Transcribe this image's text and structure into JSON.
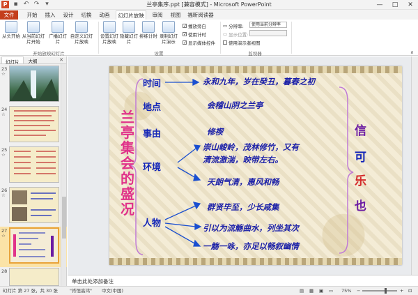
{
  "window": {
    "title": "兰亭集序.ppt [兼容模式] - Microsoft PowerPoint",
    "app_logo": "P",
    "controls": [
      "—",
      "□",
      "✕"
    ]
  },
  "tabs": [
    {
      "label": "文件"
    },
    {
      "label": "开始"
    },
    {
      "label": "插入"
    },
    {
      "label": "设计"
    },
    {
      "label": "切换"
    },
    {
      "label": "动画"
    },
    {
      "label": "幻灯片放映"
    },
    {
      "label": "审阅"
    },
    {
      "label": "视图"
    },
    {
      "label": "福昕阅读器"
    }
  ],
  "ribbon": {
    "from_start": "从头开始",
    "from_current": "从当前幻灯片开始",
    "broadcast": "广播幻灯片",
    "custom_show": "自定义幻灯片放映",
    "group1": "开始放映幻灯片",
    "setup_show": "设置幻灯片放映",
    "hide_slide": "隐藏幻灯片",
    "rehearse": "排练计时",
    "record": "录制幻灯片演示",
    "chk_narration": "播放旁白",
    "chk_timing": "使用计时",
    "chk_media": "显示媒体控件",
    "group2": "设置",
    "resolution_label": "分辨率:",
    "resolution_value": "使用当前分辨率",
    "display_label": "显示位置:",
    "presenter_view": "使用演示者视图",
    "group3": "监视器"
  },
  "leftpane": {
    "tab_slides": "幻灯片",
    "tab_outline": "大纲",
    "close": "✕",
    "slides": [
      {
        "num": "23"
      },
      {
        "num": "24"
      },
      {
        "num": "25"
      },
      {
        "num": "26"
      },
      {
        "num": "27"
      },
      {
        "num": "28"
      }
    ]
  },
  "slide": {
    "vertical_title": [
      "兰",
      "亭",
      "集",
      "会",
      "的",
      "盛",
      "况"
    ],
    "topics": [
      "时间",
      "地点",
      "事由",
      "环境",
      "人物"
    ],
    "lines": [
      "永和九年，岁在癸丑，暮春之初",
      "会稽山阴之兰亭",
      "修禊",
      "崇山峻岭，茂林修竹，又有",
      "清流激湍，映带左右。",
      "天朗气清，惠风和畅",
      "群贤毕至，少长咸集",
      "引以为流觞曲水，列坐其次",
      "一觞一咏，亦足以畅叙幽情"
    ],
    "right_chars": [
      "信",
      "可",
      "乐",
      "也"
    ],
    "right_colors": [
      "#6b1aa3",
      "#1426b8",
      "#d42a2a",
      "#6b1aa3"
    ],
    "accent_pink": "#e0338a",
    "accent_blue": "#1426b8"
  },
  "notes": {
    "placeholder": "单击此处添加备注"
  },
  "status": {
    "slide_info": "幻灯片 第 27 张，共 30 张",
    "theme": "\"肖恒高鸿\"",
    "language": "中文(中国)",
    "zoom": "75%"
  }
}
